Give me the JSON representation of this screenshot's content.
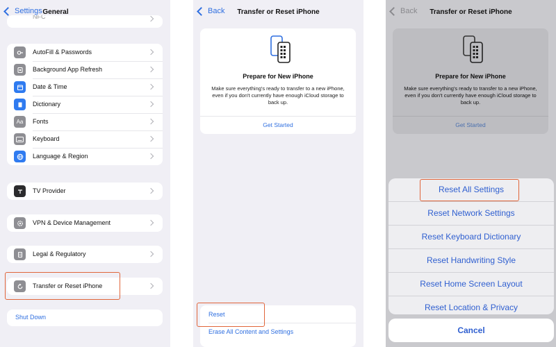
{
  "colors": {
    "accent": "#2f6fe0",
    "highlight": "#e0653a",
    "background": "#f0eff5"
  },
  "panel1": {
    "back_label": "Settings",
    "title": "General",
    "partial_top": "NFC",
    "group1": [
      {
        "icon": "autofill-key-icon",
        "label": "AutoFill & Passwords"
      },
      {
        "icon": "background-refresh-icon",
        "label": "Background App Refresh"
      },
      {
        "icon": "calendar-icon",
        "label": "Date & Time"
      },
      {
        "icon": "dictionary-book-icon",
        "label": "Dictionary"
      },
      {
        "icon": "fonts-aa-icon",
        "label": "Fonts"
      },
      {
        "icon": "keyboard-icon",
        "label": "Keyboard"
      },
      {
        "icon": "globe-icon",
        "label": "Language & Region"
      }
    ],
    "tv_provider": "TV Provider",
    "vpn": "VPN & Device Management",
    "legal": "Legal & Regulatory",
    "transfer": "Transfer or Reset iPhone",
    "shut_down": "Shut Down",
    "icon_glyphs": {
      "aa": "Aa"
    }
  },
  "panel2": {
    "back_label": "Back",
    "title": "Transfer or Reset iPhone",
    "prepare_title": "Prepare for New iPhone",
    "prepare_desc": "Make sure everything's ready to transfer to a new iPhone, even if you don't currently have enough iCloud storage to back up.",
    "get_started": "Get Started",
    "reset": "Reset",
    "erase": "Erase All Content and Settings"
  },
  "panel3": {
    "back_label": "Back",
    "title": "Transfer or Reset iPhone",
    "prepare_title": "Prepare for New iPhone",
    "prepare_desc": "Make sure everything's ready to transfer to a new iPhone, even if you don't currently have enough iCloud storage to back up.",
    "get_started": "Get Started",
    "options": [
      "Reset All Settings",
      "Reset Network Settings",
      "Reset Keyboard Dictionary",
      "Reset Handwriting Style",
      "Reset Home Screen Layout",
      "Reset Location & Privacy"
    ],
    "cancel": "Cancel"
  }
}
